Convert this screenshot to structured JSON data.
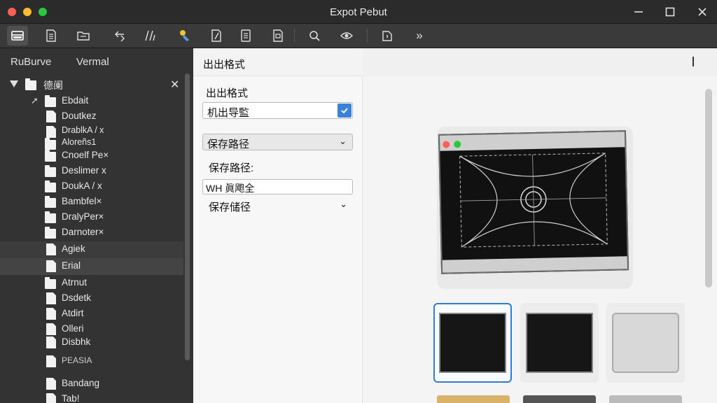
{
  "window": {
    "title": "Expot Pebut",
    "minimize_glyph": "—",
    "maximize_glyph": "☐",
    "close_glyph": "✕"
  },
  "toolbar": {
    "icons": [
      "drive-icon",
      "document-icon",
      "folder-icon",
      "back-arrows-icon",
      "slash-icon",
      "tag-icon",
      "file-edit-icon",
      "list-document-icon",
      "image-document-icon",
      "zoom-settings-icon",
      "eye-icon",
      "export-icon",
      "more-icon"
    ],
    "more_label": "»"
  },
  "sidebar": {
    "tabs": [
      "RuBurve",
      "Vermal"
    ],
    "root": {
      "label": "德阑",
      "close": "✕"
    },
    "items": [
      {
        "label": "Ebdait"
      },
      {
        "label": "Doutkez"
      },
      {
        "label": "DrablkA / x"
      },
      {
        "label": "Aloreñs1"
      },
      {
        "label": "Cnoelf Pe×"
      },
      {
        "label": "Deslimer x"
      },
      {
        "label": "DoukA / x"
      },
      {
        "label": "Bambfel×"
      },
      {
        "label": "DralyPer×"
      },
      {
        "label": "Darnoter×"
      },
      {
        "label": "Agiek"
      },
      {
        "label": "Erial"
      },
      {
        "label": "Atrnut"
      },
      {
        "label": "Dsdetk"
      },
      {
        "label": "Atdirt"
      },
      {
        "label": "Olleri"
      },
      {
        "label": "Disbhk"
      },
      {
        "label": "PEASIA"
      },
      {
        "label": "Bandang"
      },
      {
        "label": "Tab!"
      }
    ]
  },
  "panel": {
    "header": "出出格式",
    "format_label": "出出格式",
    "format_value": "机出导監",
    "path_select": "保存路径",
    "path_label": "保存路径:",
    "path_input": "WH 眞飑全",
    "save_settings": "保存储径"
  },
  "colors": {
    "accent": "#3b82d6",
    "sidebar_bg": "#333333",
    "toolbar_bg": "#3a3a3a",
    "titlebar_bg": "#2b2b2b"
  }
}
